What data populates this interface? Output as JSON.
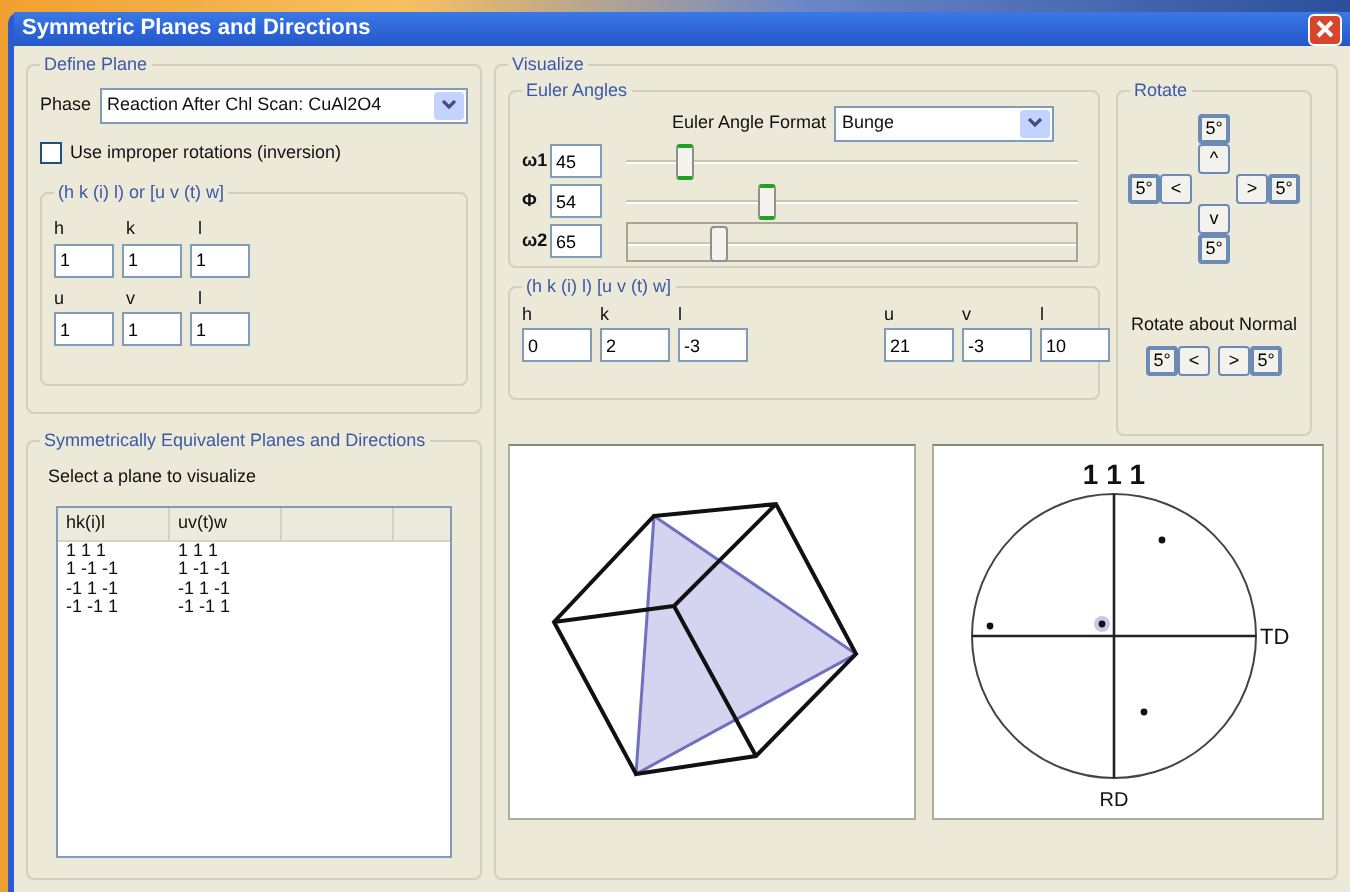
{
  "window": {
    "title": "Symmetric Planes and Directions"
  },
  "define_plane": {
    "title": "Define Plane",
    "phase_label": "Phase",
    "phase_value": "Reaction After Chl Scan: CuAl2O4",
    "improper": {
      "label": "Use improper rotations (inversion)",
      "checked": false
    },
    "indices": {
      "title": "(h k (i) l) or [u v (t) w]",
      "plane_labels": [
        "h",
        "k",
        "l"
      ],
      "plane_values": [
        "1",
        "1",
        "1"
      ],
      "direction_labels": [
        "u",
        "v",
        "l"
      ],
      "direction_values": [
        "1",
        "1",
        "1"
      ]
    }
  },
  "equivalents": {
    "title": "Symmetrically Equivalent Planes and Directions",
    "prompt": "Select a plane to visualize",
    "columns": [
      "hk(i)l",
      "uv(t)w"
    ],
    "rows": [
      [
        "1 1 1",
        "1 1 1"
      ],
      [
        "1 -1 -1",
        "1 -1 -1"
      ],
      [
        "-1 1 -1",
        "-1 1 -1"
      ],
      [
        "-1 -1 1",
        "-1 -1 1"
      ]
    ]
  },
  "visualize": {
    "title": "Visualize",
    "euler": {
      "title": "Euler Angles",
      "format_label": "Euler Angle Format",
      "format_value": "Bunge",
      "angles": [
        {
          "symbol": "ω1",
          "value": "45",
          "level": 0.13,
          "focused": false
        },
        {
          "symbol": "Φ",
          "value": "54",
          "level": 0.31,
          "focused": false
        },
        {
          "symbol": "ω2",
          "value": "65",
          "level": 0.2,
          "focused": true
        }
      ]
    },
    "indices": {
      "title": "(h k (i) l) [u v (t) w]",
      "plane_labels": [
        "h",
        "k",
        "l"
      ],
      "plane_values": [
        "0",
        "2",
        "-3"
      ],
      "direction_labels": [
        "u",
        "v",
        "l"
      ],
      "direction_values": [
        "21",
        "-3",
        "10"
      ]
    },
    "rotate": {
      "title": "Rotate",
      "up_step": "5°",
      "up": "^",
      "left_step": "5°",
      "left": "<",
      "right": ">",
      "right_step": "5°",
      "down": "v",
      "down_step": "5°",
      "normal_label": "Rotate about Normal",
      "normal_buttons": [
        "5°",
        "<",
        ">",
        "5°"
      ]
    },
    "pole_figure": {
      "title": "1 1 1",
      "right_label": "TD",
      "bottom_label": "RD"
    }
  }
}
